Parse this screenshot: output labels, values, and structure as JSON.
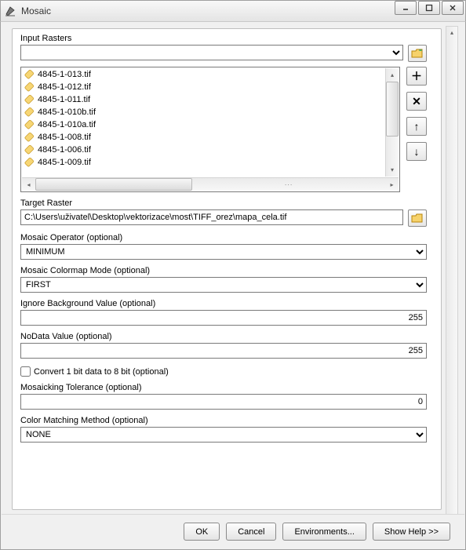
{
  "window": {
    "title": "Mosaic"
  },
  "labels": {
    "input_rasters": "Input Rasters",
    "target_raster": "Target Raster",
    "mosaic_operator": "Mosaic Operator (optional)",
    "mosaic_colormap": "Mosaic Colormap Mode (optional)",
    "ignore_bg": "Ignore Background Value (optional)",
    "nodata": "NoData Value (optional)",
    "convert_1bit": "Convert 1 bit data to 8 bit (optional)",
    "mosaic_tol": "Mosaicking Tolerance (optional)",
    "color_match": "Color Matching Method (optional)"
  },
  "values": {
    "input_selected": "",
    "target_raster": "C:\\Users\\uživatel\\Desktop\\vektorizace\\most\\TIFF_orez\\mapa_cela.tif",
    "mosaic_operator": "MINIMUM",
    "mosaic_colormap": "FIRST",
    "ignore_bg": "255",
    "nodata": "255",
    "convert_1bit_checked": false,
    "mosaic_tol": "0",
    "color_match": "NONE"
  },
  "raster_list": [
    "4845-1-013.tif",
    "4845-1-012.tif",
    "4845-1-011.tif",
    "4845-1-010b.tif",
    "4845-1-010a.tif",
    "4845-1-008.tif",
    "4845-1-006.tif",
    "4845-1-009.tif"
  ],
  "buttons": {
    "ok": "OK",
    "cancel": "Cancel",
    "environments": "Environments...",
    "show_help": "Show Help >>"
  }
}
